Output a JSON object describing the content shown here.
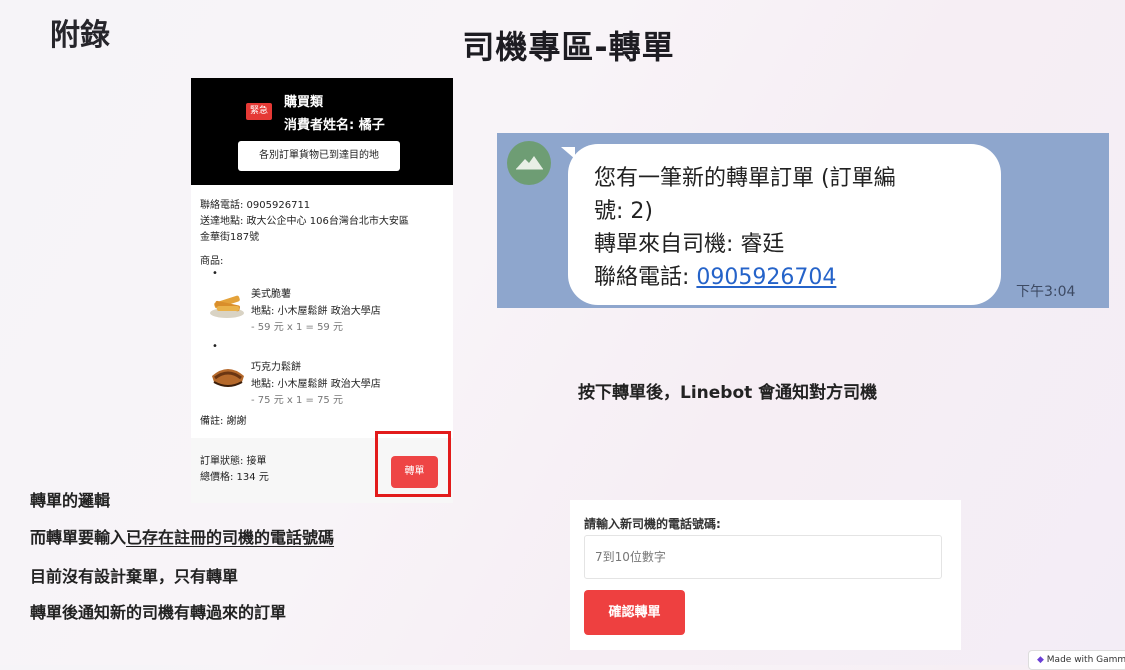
{
  "slide": {
    "appendix": "附錄",
    "title": "司機專區-轉單"
  },
  "order_card": {
    "urgent_badge": "緊急",
    "category": "購買類",
    "consumer": "消費者姓名: 橘子",
    "arrived_button": "各別訂單貨物已到達目的地",
    "phone": "聯絡電話: 0905926711",
    "address_line1": "送達地點: 政大公企中心 106台灣台北市大安區",
    "address_line2": "金華街187號",
    "goods_label": "商品:",
    "items": [
      {
        "name": "美式脆薯",
        "location": "地點: 小木屋鬆餅 政治大學店",
        "price": "- 59 元 x 1 = 59 元"
      },
      {
        "name": "巧克力鬆餅",
        "location": "地點: 小木屋鬆餅 政治大學店",
        "price": "- 75 元 x 1 = 75 元"
      }
    ],
    "bullet": "•",
    "note": "備註: 謝謝",
    "status": "訂單狀態: 接單",
    "total": "總價格: 134 元",
    "transfer_button": "轉單"
  },
  "chat": {
    "line1": "您有一筆新的轉單訂單 (訂單編",
    "line2": "號: 2)",
    "line3": "轉單來自司機: 睿廷",
    "line4_label": "聯絡電話: ",
    "line4_phone": "0905926704",
    "time": "下午3:04"
  },
  "caption": "按下轉單後，Linebot 會通知對方司機",
  "notes": {
    "heading": "轉單的邏輯",
    "line1_prefix": "而轉單要輸入",
    "line1_underlined": "已存在註冊的司機的電話號碼",
    "line2": "目前沒有設計棄單，只有轉單",
    "line3": "轉單後通知新的司機有轉過來的訂單"
  },
  "form": {
    "label": "請輸入新司機的電話號碼:",
    "placeholder": "7到10位數字",
    "confirm_button": "確認轉單"
  },
  "badge": {
    "icon": "gamma-logo-icon",
    "text": "Made with Gamma"
  },
  "colors": {
    "accent_red": "#ee4545",
    "chat_background": "#8ea6cd",
    "link_blue": "#2563c9"
  }
}
